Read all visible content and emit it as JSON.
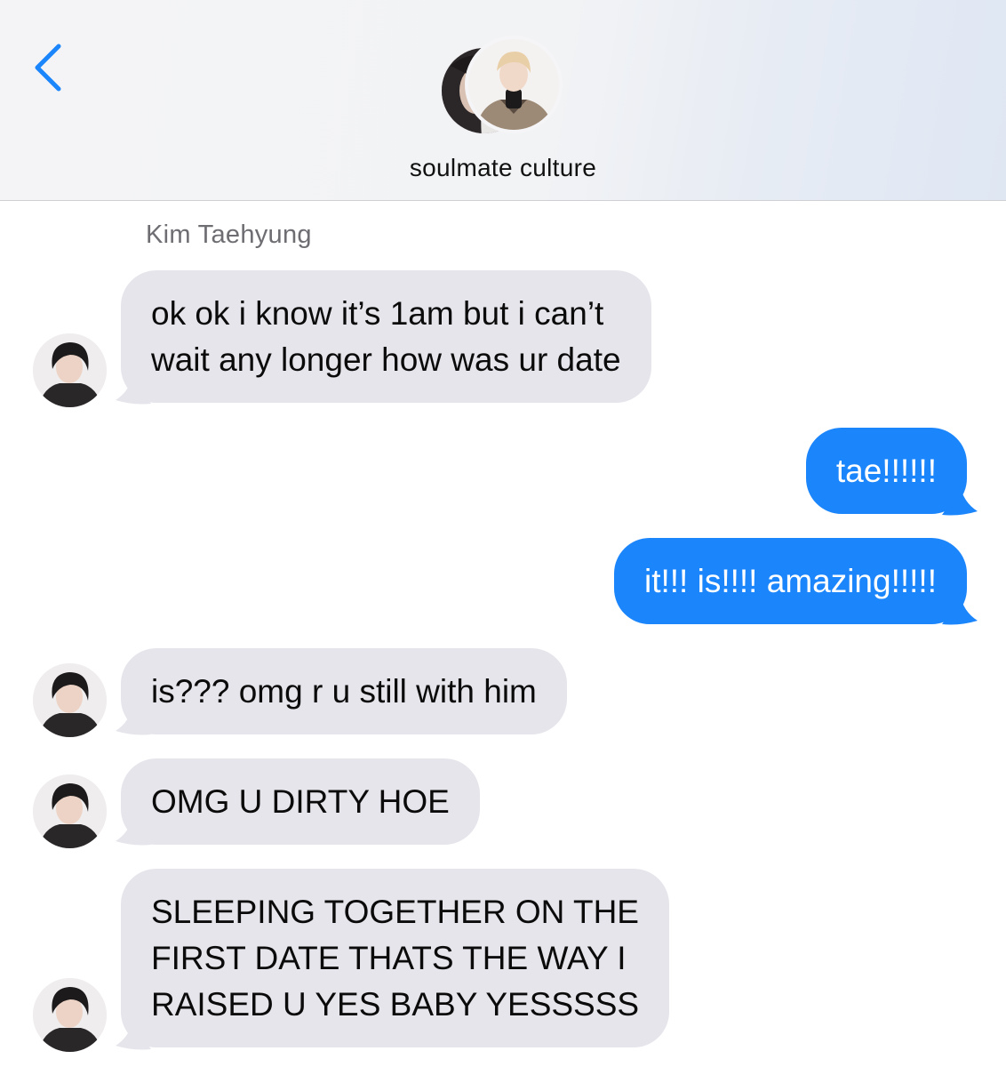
{
  "header": {
    "chat_title": "soulmate culture",
    "back_icon": "chevron-left-icon",
    "accent_color": "#1b85fb"
  },
  "thread": {
    "sender_name": "Kim Taehyung",
    "messages": [
      {
        "direction": "incoming",
        "lines": [
          "ok ok i know it’s 1am but i can’t",
          "wait any longer how was ur date"
        ]
      },
      {
        "direction": "outgoing",
        "lines": [
          "tae!!!!!!"
        ]
      },
      {
        "direction": "outgoing",
        "lines": [
          "it!!! is!!!! amazing!!!!!"
        ]
      },
      {
        "direction": "incoming",
        "lines": [
          "is??? omg r u still with him"
        ]
      },
      {
        "direction": "incoming",
        "lines": [
          "OMG U DIRTY HOE"
        ]
      },
      {
        "direction": "incoming",
        "lines": [
          "SLEEPING TOGETHER ON THE",
          "FIRST DATE THATS THE WAY I",
          "RAISED U YES BABY YESSSSS"
        ]
      }
    ]
  },
  "colors": {
    "incoming_bubble": "#e6e5eb",
    "outgoing_bubble": "#1b85fb"
  }
}
